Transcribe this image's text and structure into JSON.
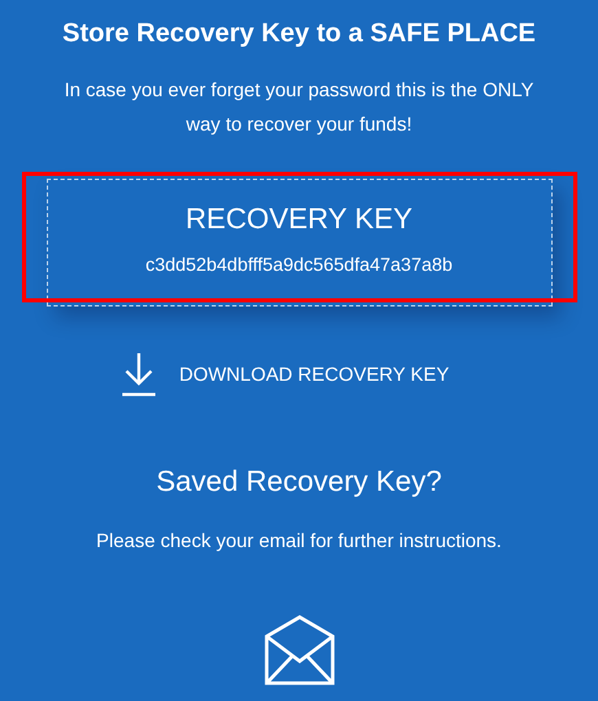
{
  "title": "Store Recovery Key to a SAFE PLACE",
  "subtitle": "In case you ever forget your password this is the ONLY way to recover your funds!",
  "recovery_key": {
    "label": "RECOVERY KEY",
    "value": "c3dd52b4dbfff5a9dc565dfa47a37a8b",
    "highlighted": true
  },
  "download_link": "DOWNLOAD RECOVERY KEY",
  "saved_heading": "Saved Recovery Key?",
  "saved_text": "Please check your email for further instructions."
}
